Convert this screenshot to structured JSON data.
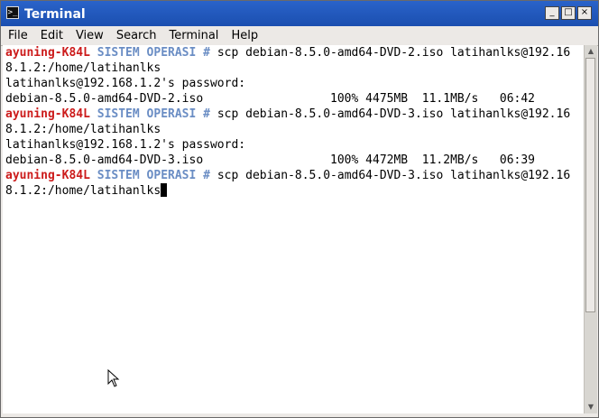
{
  "window": {
    "title": "Terminal",
    "app_icon": "terminal-icon",
    "controls": {
      "minimize": "_",
      "maximize": "□",
      "close": "×"
    }
  },
  "menubar": {
    "items": [
      "File",
      "Edit",
      "View",
      "Search",
      "Terminal",
      "Help"
    ]
  },
  "terminal": {
    "prompt_user": "ayuning-K84L",
    "prompt_dir": "SISTEM OPERASI",
    "prompt_symbol": "#",
    "lines": [
      {
        "kind": "prompt",
        "command": "scp debian-8.5.0-amd64-DVD-2.iso latihanlks@192.16"
      },
      {
        "kind": "text",
        "text": "8.1.2:/home/latihanlks"
      },
      {
        "kind": "text",
        "text": "latihanlks@192.168.1.2's password:"
      },
      {
        "kind": "text",
        "text": "debian-8.5.0-amd64-DVD-2.iso                  100% 4475MB  11.1MB/s   06:42"
      },
      {
        "kind": "prompt",
        "command": "scp debian-8.5.0-amd64-DVD-3.iso latihanlks@192.16"
      },
      {
        "kind": "text",
        "text": "8.1.2:/home/latihanlks"
      },
      {
        "kind": "text",
        "text": "latihanlks@192.168.1.2's password:"
      },
      {
        "kind": "text",
        "text": "debian-8.5.0-amd64-DVD-3.iso                  100% 4472MB  11.2MB/s   06:39"
      },
      {
        "kind": "prompt",
        "command": "scp debian-8.5.0-amd64-DVD-3.iso latihanlks@192.16"
      },
      {
        "kind": "text_cursor",
        "text": "8.1.2:/home/latihanlks"
      }
    ]
  },
  "colors": {
    "titlebar": "#1b4fb0",
    "prompt_user": "#cc1b1b",
    "prompt_dir": "#6a8dc4",
    "terminal_bg": "#ffffff"
  }
}
